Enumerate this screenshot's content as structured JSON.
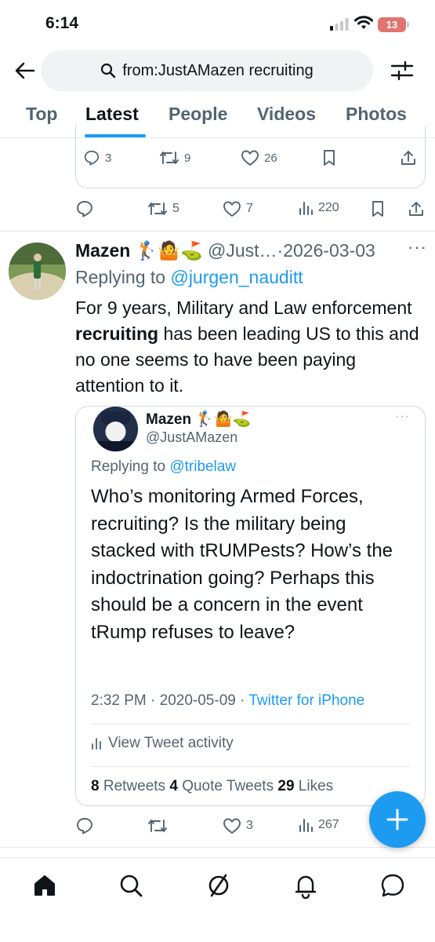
{
  "status_bar": {
    "time": "6:14",
    "battery": "13"
  },
  "search": {
    "query": "from:JustAMazen recruiting"
  },
  "tabs": [
    {
      "label": "Top"
    },
    {
      "label": "Latest"
    },
    {
      "label": "People"
    },
    {
      "label": "Videos"
    },
    {
      "label": "Photos"
    }
  ],
  "previous_quote_actions": {
    "replies": "3",
    "retweets": "9",
    "likes": "26"
  },
  "previous_tweet_actions": {
    "retweets": "5",
    "likes": "7",
    "views": "220"
  },
  "tweet": {
    "name": "Mazen",
    "emojis": "🏌🤷⛳",
    "handle": "@Just…",
    "date": "·2026-03-03",
    "replying_prefix": "Replying to ",
    "replying_to": "@jurgen_nauditt",
    "body_1": "For 9 years, Military and Law enforcement ",
    "body_bold": "recruiting",
    "body_2": " has been leading US to this and no one seems to have been paying attention to it.",
    "actions": {
      "likes": "3",
      "views": "267"
    }
  },
  "quote": {
    "name": "Mazen",
    "emojis": "🏌🤷⛳",
    "handle": "@JustAMazen",
    "replying_prefix": "Replying to ",
    "replying_to": "@tribelaw",
    "body": "Who’s monitoring Armed Forces, recruiting? Is the military being stacked with tRUMPests? How’s the indoctrination going? Perhaps this should be a concern in the event tRump refuses to leave?",
    "time": "2:32 PM · 2020-05-09 · ",
    "source": "Twitter for iPhone",
    "activity_label": "View Tweet activity",
    "retweets_count": "8",
    "retweets_label": " Retweets ",
    "quotes_count": "4",
    "quotes_label": " Quote Tweets ",
    "likes_count": "29",
    "likes_label": " Likes"
  },
  "colors": {
    "accent": "#1d9bf0",
    "text": "#0f1419",
    "secondary": "#536471"
  },
  "icons": [
    "back-arrow-icon",
    "search-icon",
    "filter-icon",
    "reply-icon",
    "retweet-icon",
    "like-icon",
    "views-icon",
    "bookmark-icon",
    "share-icon",
    "compose-icon",
    "home-icon",
    "explore-icon",
    "spaces-icon",
    "notifications-icon",
    "messages-icon"
  ]
}
